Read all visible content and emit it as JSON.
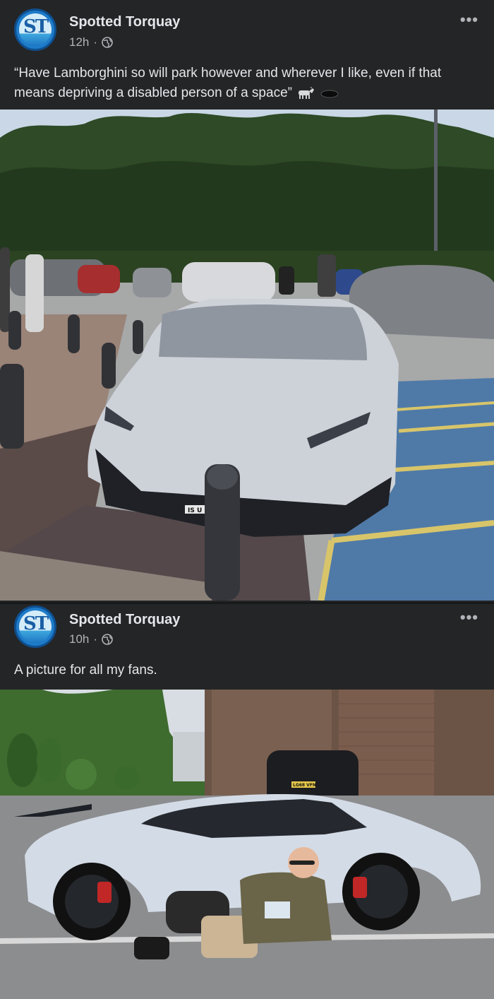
{
  "posts": [
    {
      "author": "Spotted Torquay",
      "time": "12h",
      "separator": "·",
      "more_label": "•••",
      "caption": "“Have Lamborghini so will park however and wherever I like, even if that means depriving a disabled person of a space”",
      "license_plate_partial": "IS U"
    },
    {
      "author": "Spotted Torquay",
      "time": "10h",
      "separator": "·",
      "more_label": "•••",
      "caption": "A picture for all my fans.",
      "license_plate": "LG68 VFN"
    }
  ],
  "colors": {
    "background": "#242526",
    "text_primary": "#e4e6eb",
    "text_secondary": "#b0b3b8",
    "avatar_blue": "#1e7bc9"
  },
  "icons": {
    "privacy": "globe-icon",
    "menu": "more-options-icon",
    "emoji_1": "goat-emoji-icon",
    "emoji_2": "hole-emoji-icon"
  }
}
